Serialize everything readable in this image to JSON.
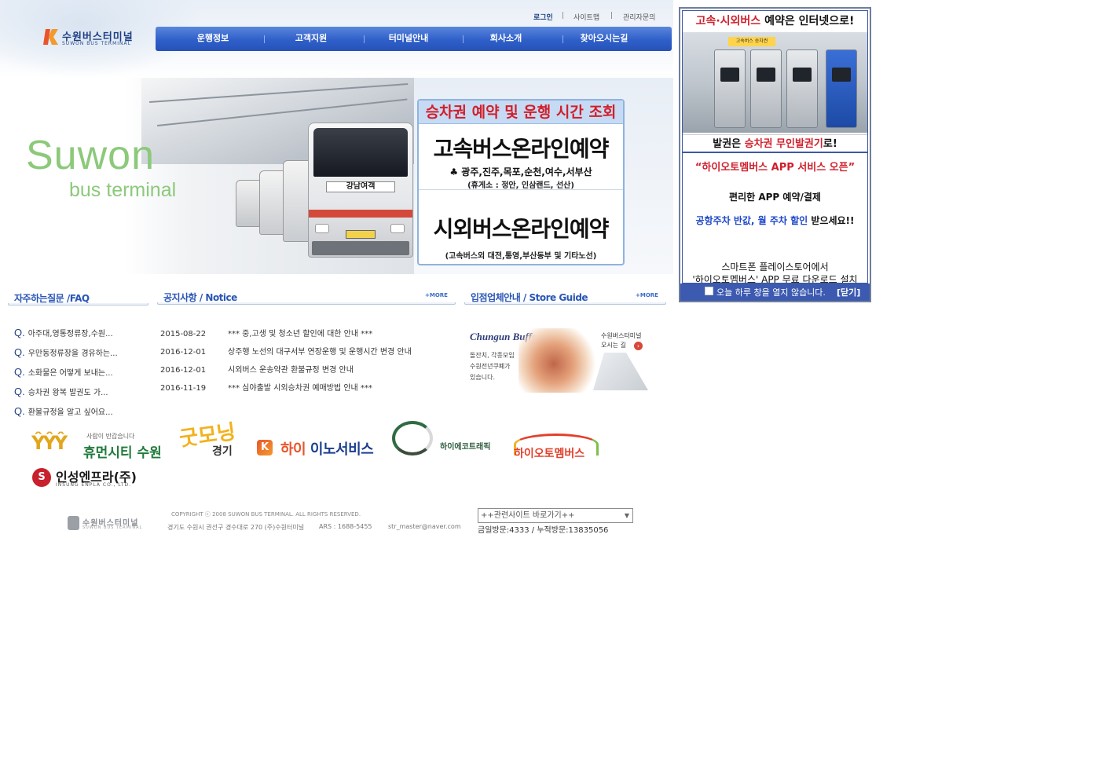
{
  "header": {
    "logo_ko": "수원버스터미널",
    "logo_en": "SUWON BUS TERMINAL",
    "util": {
      "login": "로그인",
      "sitemap": "사이트맵",
      "admin": "관리자문의",
      "separator": "|"
    },
    "nav": [
      "운행정보",
      "고객지원",
      "터미널안내",
      "회사소개",
      "찾아오시는길"
    ]
  },
  "visual": {
    "suwon": "Suwon",
    "bus_terminal": "bus terminal",
    "bus_sign": "강남여객",
    "booking": {
      "header": "승차권 예약 및 운행 시간 조회",
      "express_title": "고속버스온라인예약",
      "express_routes": "♣ 광주,진주,목포,순천,여수,서부산",
      "express_rest": "(휴게소 : 정안, 인삼랜드, 선산)",
      "intercity_title": "시외버스온라인예약",
      "intercity_routes": "(고속버스외 대전,통영,부산동부 및 기타노선)"
    }
  },
  "faq": {
    "title": "자주하는질문 /FAQ",
    "q_mark": "Q.",
    "items": [
      "아주대,영통정류장,수원...",
      "우만동정류장을 경유하는...",
      "소화물은 어떻게 보내는...",
      "승차권 왕복 발권도 가...",
      "환불규정을 알고 싶어요..."
    ]
  },
  "notice": {
    "title": "공지사항 / Notice",
    "more": "+MORE",
    "items": [
      {
        "date": "2015-08-22",
        "title": "*** 중,고생 및 청소년 할인에 대한 안내 ***"
      },
      {
        "date": "2016-12-01",
        "title": "상주행 노선의 대구서부 연장운행 및 운행시간 변경 안내"
      },
      {
        "date": "2016-12-01",
        "title": "시외버스 운송약관 환불규정 변경 안내"
      },
      {
        "date": "2016-11-19",
        "title": "*** 심야출발 시외승차권 예매방법 안내 ***"
      }
    ]
  },
  "store": {
    "title": "입점업체안내 / Store Guide",
    "more": "+MORE",
    "brand": "Chungun Buffet",
    "desc": [
      "돌잔치, 각종모임",
      "수원전년쿠폐가",
      "있습니다."
    ],
    "sign": [
      "수원버스터미널",
      "오시는 길"
    ]
  },
  "partners": {
    "human_city": "휴먼시티 수원",
    "human_tag": "사람이 반갑습니다",
    "gyeonggi_word": "굿모닝",
    "gyeonggi_sub": "경기",
    "hiinno_hi": "하이",
    "hiinno_rest": " 이노서비스",
    "hieco": "하이에코트래픽",
    "hiauto": "하이오토멤버스",
    "insung": "인성엔프라(주)",
    "insung_en": "INSUNG ENPLA CO., LTD."
  },
  "footer": {
    "logo_ko": "수원버스터미널",
    "logo_en": "SUWON BUS TERMINAL",
    "copyright": "COPYRIGHT ⓒ 2008 SUWON BUS TERMINAL.   ALL RIGHTS RESERVED.",
    "address": "경기도 수원시 권선구 경수대로 270  (주)수원터미널",
    "ars": "ARS : 1688-5455",
    "email": "str_master@naver.com",
    "related_select": "++관련사이트 바로가기++",
    "visits": "금일방문:4333 / 누적방문:13835056"
  },
  "popup": {
    "head_red": "고속·시외버스",
    "head_rest": " 예약은 인터넷으로!",
    "kiosk_sign": "고속버스 승차권",
    "caption_pre": "발권은 ",
    "caption_red": "승차권 무인발권기",
    "caption_post": "로!",
    "app_title": "“하이오토멤버스 APP 서비스 오픈”",
    "line1": "편리한 APP 예약/결제",
    "line2_blue": "공항주차 반값, 월 주차 할인",
    "line2_rest": " 받으세요!!",
    "line3": "스마트폰 플레이스토어에서",
    "line4": "'하이오토멤버스' APP 무료 다운로드 설치",
    "dont_show": "오늘 하루 창을 열지 않습니다.",
    "close": "[닫기]"
  },
  "colors": {
    "nav_blue": "#2f5fc9",
    "accent_red": "#d0202c",
    "section_blue": "#2a56b5"
  }
}
